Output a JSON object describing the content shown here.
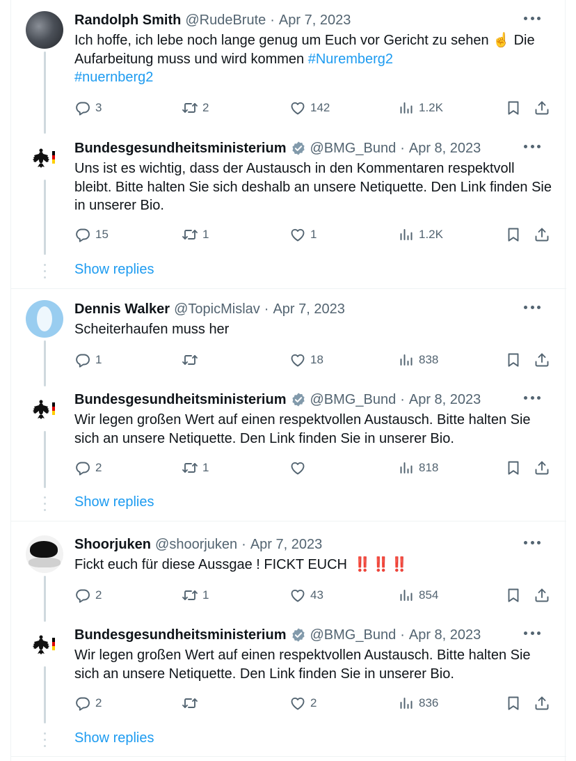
{
  "colors": {
    "accent": "#1d9bf0",
    "secondary": "#536471",
    "verified": "#829aab",
    "line": "#cfd9de"
  },
  "icons": [
    "reply-icon",
    "retweet-icon",
    "like-icon",
    "views-icon",
    "bookmark-icon",
    "share-icon",
    "verified-icon",
    "more-icon"
  ],
  "threads": [
    {
      "reply": {
        "name": "Randolph Smith",
        "handle": "@RudeBrute",
        "sep": "·",
        "date": "Apr 7, 2023",
        "text_1": "Ich hoffe, ich lebe noch lange genug um Euch vor Gericht zu sehen ☝️ Die Aufarbeitung muss und wird kommen",
        "hashtag_1": "#Nuremberg2",
        "hashtag_2": "#nuernberg2",
        "replies": "3",
        "retweets": "2",
        "likes": "142",
        "views": "1.2K"
      },
      "answer": {
        "name": "Bundesgesundheitsministerium",
        "handle": "@BMG_Bund",
        "sep": "·",
        "date": "Apr 8, 2023",
        "text": "Uns ist es wichtig, dass der Austausch in den Kommentaren respektvoll bleibt. Bitte halten Sie sich deshalb an unsere Netiquette. Den Link finden Sie in unserer Bio.",
        "replies": "15",
        "retweets": "1",
        "likes": "1",
        "views": "1.2K"
      },
      "show_replies": "Show replies"
    },
    {
      "reply": {
        "name": "Dennis Walker",
        "handle": "@TopicMislav",
        "sep": "·",
        "date": "Apr 7, 2023",
        "text": "Scheiterhaufen muss her",
        "replies": "1",
        "retweets": "",
        "likes": "18",
        "views": "838"
      },
      "answer": {
        "name": "Bundesgesundheitsministerium",
        "handle": "@BMG_Bund",
        "sep": "·",
        "date": "Apr 8, 2023",
        "text": "Wir legen großen Wert auf einen respektvollen Austausch. Bitte halten Sie sich an unsere Netiquette. Den Link finden Sie in unserer Bio.",
        "replies": "2",
        "retweets": "1",
        "likes": "",
        "views": "818"
      },
      "show_replies": "Show replies"
    },
    {
      "reply": {
        "name": "Shoorjuken",
        "handle": "@shoorjuken",
        "sep": "·",
        "date": "Apr 7, 2023",
        "text": "Fickt euch für diese Aussgae ! FICKT EUCH",
        "emoji": "‼️ ‼️ ‼️",
        "replies": "2",
        "retweets": "1",
        "likes": "43",
        "views": "854"
      },
      "answer": {
        "name": "Bundesgesundheitsministerium",
        "handle": "@BMG_Bund",
        "sep": "·",
        "date": "Apr 8, 2023",
        "text": "Wir legen großen Wert auf einen respektvollen Austausch. Bitte halten Sie sich an unsere Netiquette. Den Link finden Sie in unserer Bio.",
        "replies": "2",
        "retweets": "",
        "likes": "2",
        "views": "836"
      },
      "show_replies": "Show replies"
    }
  ]
}
